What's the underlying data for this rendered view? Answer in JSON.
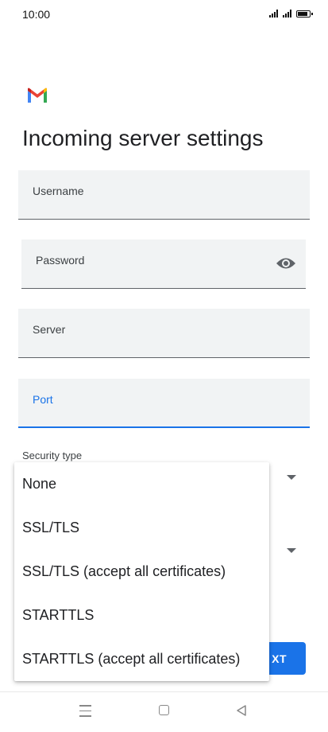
{
  "status_bar": {
    "time": "10:00"
  },
  "page": {
    "title": "Incoming server settings"
  },
  "fields": {
    "username": {
      "label": "Username",
      "value": ""
    },
    "password": {
      "label": "Password",
      "value": ""
    },
    "server": {
      "label": "Server",
      "value": ""
    },
    "port": {
      "label": "Port",
      "value": ""
    }
  },
  "security": {
    "label": "Security type"
  },
  "dropdown": {
    "options": [
      "None",
      "SSL/TLS",
      "SSL/TLS (accept all certificates)",
      "STARTTLS",
      "STARTTLS (accept all certificates)"
    ]
  },
  "actions": {
    "next_label": "XT"
  },
  "icons": {
    "brand": "gmail-logo",
    "password_toggle": "eye-icon",
    "nav": [
      "menu-icon",
      "home-icon",
      "back-icon"
    ]
  },
  "colors": {
    "accent": "#1a73e8",
    "field_bg": "#f1f3f4"
  }
}
